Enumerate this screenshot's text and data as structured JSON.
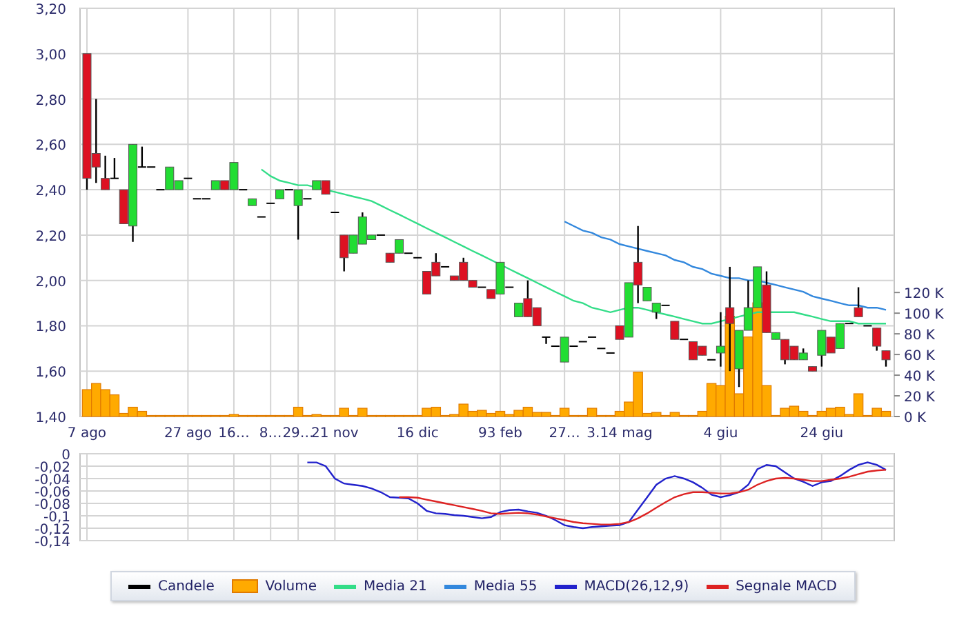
{
  "price_panel": {
    "chart_data": {
      "type": "candlestick",
      "grid": true,
      "categories": [
        "7 ago",
        null,
        null,
        null,
        null,
        null,
        null,
        null,
        null,
        null,
        null,
        "27 ago",
        null,
        null,
        null,
        null,
        "16…",
        null,
        null,
        null,
        "8…",
        null,
        null,
        "29…",
        null,
        null,
        null,
        "21 nov",
        null,
        null,
        null,
        null,
        null,
        null,
        null,
        null,
        "16 dic",
        null,
        null,
        null,
        null,
        null,
        null,
        null,
        null,
        "93 feb",
        null,
        null,
        null,
        null,
        null,
        null,
        "27…",
        null,
        null,
        null,
        null,
        null,
        "3.14 mag",
        null,
        null,
        null,
        null,
        null,
        null,
        null,
        null,
        null,
        null,
        "4 giu",
        null,
        null,
        null,
        null,
        null,
        null,
        null,
        null,
        null,
        null,
        "24 giu",
        null,
        null,
        null,
        null,
        null,
        null,
        null
      ],
      "ylim": [
        1.4,
        3.2
      ],
      "y2lim": [
        0,
        395
      ],
      "yticks": [
        {
          "value": 3.2,
          "label": "3,20"
        },
        {
          "value": 3.0,
          "label": "3,00"
        },
        {
          "value": 2.8,
          "label": "2,80"
        },
        {
          "value": 2.6,
          "label": "2,60"
        },
        {
          "value": 2.4,
          "label": "2,40"
        },
        {
          "value": 2.2,
          "label": "2,20"
        },
        {
          "value": 2.0,
          "label": "2,00"
        },
        {
          "value": 1.8,
          "label": "1,80"
        },
        {
          "value": 1.6,
          "label": "1,60"
        },
        {
          "value": 1.4,
          "label": "1,40"
        }
      ],
      "y2ticks": [
        {
          "value": 120,
          "label": "120 K"
        },
        {
          "value": 100,
          "label": "100 K"
        },
        {
          "value": 80,
          "label": "80 K"
        },
        {
          "value": 60,
          "label": "60 K"
        },
        {
          "value": 40,
          "label": "40 K"
        },
        {
          "value": 20,
          "label": "20 K"
        },
        {
          "value": 0,
          "label": "0 K"
        }
      ],
      "ohlc": [
        [
          3.0,
          3.0,
          2.4,
          2.45
        ],
        [
          2.56,
          2.8,
          2.43,
          2.5
        ],
        [
          2.45,
          2.55,
          2.4,
          2.4
        ],
        [
          2.45,
          2.54,
          2.45,
          2.45
        ],
        [
          2.4,
          2.4,
          2.25,
          2.25
        ],
        [
          2.24,
          2.6,
          2.17,
          2.6
        ],
        [
          2.5,
          2.59,
          2.5,
          2.5
        ],
        [
          2.5,
          2.5,
          2.5,
          2.5
        ],
        [
          2.4,
          2.4,
          2.4,
          2.4
        ],
        [
          2.4,
          2.5,
          2.4,
          2.5
        ],
        [
          2.4,
          2.44,
          2.4,
          2.44
        ],
        [
          2.45,
          2.45,
          2.45,
          2.45
        ],
        [
          2.36,
          2.36,
          2.36,
          2.36
        ],
        [
          2.36,
          2.36,
          2.36,
          2.36
        ],
        [
          2.4,
          2.44,
          2.4,
          2.44
        ],
        [
          2.44,
          2.44,
          2.4,
          2.4
        ],
        [
          2.4,
          2.52,
          2.4,
          2.52
        ],
        [
          2.4,
          2.4,
          2.4,
          2.4
        ],
        [
          2.33,
          2.36,
          2.33,
          2.36
        ],
        [
          2.28,
          2.28,
          2.28,
          2.28
        ],
        [
          2.34,
          2.34,
          2.34,
          2.34
        ],
        [
          2.36,
          2.4,
          2.36,
          2.4
        ],
        [
          2.4,
          2.4,
          2.4,
          2.4
        ],
        [
          2.33,
          2.4,
          2.18,
          2.4
        ],
        [
          2.36,
          2.36,
          2.36,
          2.36
        ],
        [
          2.4,
          2.44,
          2.4,
          2.44
        ],
        [
          2.44,
          2.44,
          2.38,
          2.38
        ],
        [
          2.3,
          2.3,
          2.3,
          2.3
        ],
        [
          2.2,
          2.2,
          2.04,
          2.1
        ],
        [
          2.12,
          2.2,
          2.12,
          2.2
        ],
        [
          2.16,
          2.3,
          2.16,
          2.28
        ],
        [
          2.18,
          2.2,
          2.18,
          2.2
        ],
        [
          2.2,
          2.2,
          2.2,
          2.2
        ],
        [
          2.12,
          2.12,
          2.08,
          2.08
        ],
        [
          2.12,
          2.18,
          2.12,
          2.18
        ],
        [
          2.12,
          2.12,
          2.12,
          2.12
        ],
        [
          2.1,
          2.1,
          2.1,
          2.1
        ],
        [
          2.04,
          2.04,
          1.94,
          1.94
        ],
        [
          2.08,
          2.12,
          2.02,
          2.02
        ],
        [
          2.06,
          2.06,
          2.06,
          2.06
        ],
        [
          2.02,
          2.02,
          2.0,
          2.0
        ],
        [
          2.08,
          2.1,
          2.0,
          2.0
        ],
        [
          2.0,
          2.0,
          1.97,
          1.97
        ],
        [
          1.97,
          1.97,
          1.97,
          1.97
        ],
        [
          1.96,
          1.96,
          1.92,
          1.92
        ],
        [
          1.94,
          2.08,
          1.94,
          2.08
        ],
        [
          1.97,
          1.97,
          1.97,
          1.97
        ],
        [
          1.84,
          1.9,
          1.84,
          1.9
        ],
        [
          1.92,
          2.0,
          1.84,
          1.84
        ],
        [
          1.88,
          1.88,
          1.8,
          1.8
        ],
        [
          1.75,
          1.75,
          1.72,
          1.75
        ],
        [
          1.71,
          1.71,
          1.71,
          1.71
        ],
        [
          1.64,
          1.75,
          1.64,
          1.75
        ],
        [
          1.71,
          1.71,
          1.71,
          1.71
        ],
        [
          1.73,
          1.73,
          1.73,
          1.73
        ],
        [
          1.75,
          1.75,
          1.75,
          1.75
        ],
        [
          1.7,
          1.7,
          1.7,
          1.7
        ],
        [
          1.68,
          1.68,
          1.68,
          1.68
        ],
        [
          1.8,
          1.8,
          1.74,
          1.74
        ],
        [
          1.75,
          1.99,
          1.75,
          1.99
        ],
        [
          2.08,
          2.24,
          1.9,
          1.98
        ],
        [
          1.91,
          1.97,
          1.91,
          1.97
        ],
        [
          1.86,
          1.9,
          1.83,
          1.9
        ],
        [
          1.89,
          1.89,
          1.89,
          1.89
        ],
        [
          1.82,
          1.82,
          1.74,
          1.74
        ],
        [
          1.74,
          1.74,
          1.74,
          1.74
        ],
        [
          1.73,
          1.73,
          1.65,
          1.65
        ],
        [
          1.71,
          1.71,
          1.67,
          1.67
        ],
        [
          1.65,
          1.65,
          1.65,
          1.65
        ],
        [
          1.68,
          1.86,
          1.62,
          1.71
        ],
        [
          1.88,
          2.06,
          1.6,
          1.81
        ],
        [
          1.61,
          1.78,
          1.53,
          1.78
        ],
        [
          1.78,
          2.0,
          1.78,
          1.88
        ],
        [
          1.88,
          2.06,
          1.88,
          2.06
        ],
        [
          1.98,
          2.04,
          1.77,
          1.77
        ],
        [
          1.74,
          1.77,
          1.74,
          1.77
        ],
        [
          1.74,
          1.74,
          1.63,
          1.65
        ],
        [
          1.71,
          1.71,
          1.65,
          1.65
        ],
        [
          1.65,
          1.7,
          1.65,
          1.68
        ],
        [
          1.62,
          1.62,
          1.6,
          1.6
        ],
        [
          1.67,
          1.78,
          1.62,
          1.78
        ],
        [
          1.75,
          1.75,
          1.68,
          1.68
        ],
        [
          1.7,
          1.81,
          1.7,
          1.81
        ],
        [
          1.81,
          1.81,
          1.81,
          1.81
        ],
        [
          1.88,
          1.97,
          1.84,
          1.84
        ],
        [
          1.8,
          1.8,
          1.8,
          1.8
        ],
        [
          1.79,
          1.79,
          1.69,
          1.71
        ],
        [
          1.69,
          1.69,
          1.62,
          1.65
        ]
      ],
      "series": [
        {
          "name": "Volume",
          "type": "bar",
          "axis": "y2",
          "color": "#ffaa00",
          "values": [
            26,
            32,
            26,
            21,
            3,
            9,
            5,
            1,
            1,
            1,
            1,
            1,
            1,
            1,
            1,
            1,
            2,
            1,
            1,
            1,
            1,
            1,
            1,
            9,
            1,
            2,
            1,
            1,
            8,
            1,
            8,
            1,
            1,
            1,
            1,
            1,
            1,
            8,
            9,
            1,
            2,
            12,
            5,
            6,
            3,
            5,
            2,
            6,
            9,
            4,
            4,
            1,
            8,
            1,
            1,
            8,
            1,
            1,
            5,
            14,
            43,
            3,
            4,
            1,
            4,
            1,
            1,
            5,
            32,
            30,
            97,
            22,
            77,
            110,
            30,
            1,
            8,
            10,
            5,
            1,
            5,
            8,
            9,
            2,
            22,
            1,
            8,
            5
          ]
        },
        {
          "name": "Media 21",
          "type": "line",
          "color": "#33dd88",
          "values": [
            null,
            null,
            null,
            null,
            null,
            null,
            null,
            null,
            null,
            null,
            null,
            null,
            null,
            null,
            null,
            null,
            null,
            null,
            null,
            2.49,
            2.46,
            2.44,
            2.43,
            2.42,
            2.42,
            2.41,
            2.4,
            2.39,
            2.38,
            2.37,
            2.36,
            2.35,
            2.33,
            2.31,
            2.29,
            2.27,
            2.25,
            2.23,
            2.21,
            2.19,
            2.17,
            2.15,
            2.13,
            2.11,
            2.09,
            2.07,
            2.05,
            2.03,
            2.01,
            1.99,
            1.97,
            1.95,
            1.93,
            1.91,
            1.9,
            1.88,
            1.87,
            1.86,
            1.87,
            1.88,
            1.88,
            1.87,
            1.86,
            1.85,
            1.84,
            1.83,
            1.82,
            1.81,
            1.81,
            1.82,
            1.83,
            1.84,
            1.85,
            1.86,
            1.86,
            1.86,
            1.86,
            1.86,
            1.85,
            1.84,
            1.83,
            1.82,
            1.82,
            1.82,
            1.81,
            1.81,
            1.81,
            1.81
          ]
        },
        {
          "name": "Media 55",
          "type": "line",
          "color": "#3388dd",
          "values": [
            null,
            null,
            null,
            null,
            null,
            null,
            null,
            null,
            null,
            null,
            null,
            null,
            null,
            null,
            null,
            null,
            null,
            null,
            null,
            null,
            null,
            null,
            null,
            null,
            null,
            null,
            null,
            null,
            null,
            null,
            null,
            null,
            null,
            null,
            null,
            null,
            null,
            null,
            null,
            null,
            null,
            null,
            null,
            null,
            null,
            null,
            null,
            null,
            null,
            null,
            null,
            null,
            2.26,
            2.24,
            2.22,
            2.21,
            2.19,
            2.18,
            2.16,
            2.15,
            2.14,
            2.13,
            2.12,
            2.11,
            2.09,
            2.08,
            2.06,
            2.05,
            2.03,
            2.02,
            2.01,
            2.01,
            2.0,
            2.0,
            1.99,
            1.98,
            1.97,
            1.96,
            1.95,
            1.93,
            1.92,
            1.91,
            1.9,
            1.89,
            1.89,
            1.88,
            1.88,
            1.87
          ]
        }
      ]
    },
    "candle_legend": {
      "label": "Candele",
      "color": "#000000"
    }
  },
  "macd_panel": {
    "chart_data": {
      "type": "line",
      "grid": true,
      "ylim": [
        -0.14,
        0
      ],
      "yticks": [
        {
          "value": 0,
          "label": "0"
        },
        {
          "value": -0.02,
          "label": "-0,02"
        },
        {
          "value": -0.04,
          "label": "-0,04"
        },
        {
          "value": -0.06,
          "label": "-0,06"
        },
        {
          "value": -0.08,
          "label": "-0,08"
        },
        {
          "value": -0.1,
          "label": "-0,1"
        },
        {
          "value": -0.12,
          "label": "-0,12"
        },
        {
          "value": -0.14,
          "label": "-0,14"
        }
      ],
      "series": [
        {
          "name": "MACD(26,12,9)",
          "color": "#2222cc",
          "values": [
            null,
            null,
            null,
            null,
            null,
            null,
            null,
            null,
            null,
            null,
            null,
            null,
            null,
            null,
            null,
            null,
            null,
            null,
            null,
            null,
            null,
            null,
            null,
            null,
            -0.014,
            -0.014,
            -0.02,
            -0.04,
            -0.048,
            -0.05,
            -0.052,
            -0.056,
            -0.062,
            -0.07,
            -0.071,
            -0.072,
            -0.08,
            -0.092,
            -0.096,
            -0.097,
            -0.099,
            -0.1,
            -0.102,
            -0.104,
            -0.102,
            -0.094,
            -0.091,
            -0.09,
            -0.093,
            -0.095,
            -0.1,
            -0.107,
            -0.115,
            -0.118,
            -0.12,
            -0.118,
            -0.117,
            -0.116,
            -0.115,
            -0.11,
            -0.09,
            -0.07,
            -0.05,
            -0.04,
            -0.036,
            -0.04,
            -0.046,
            -0.055,
            -0.066,
            -0.07,
            -0.067,
            -0.062,
            -0.05,
            -0.025,
            -0.018,
            -0.02,
            -0.03,
            -0.04,
            -0.045,
            -0.052,
            -0.046,
            -0.044,
            -0.036,
            -0.026,
            -0.018,
            -0.014,
            -0.018,
            -0.026
          ]
        },
        {
          "name": "Segnale MACD",
          "color": "#dd2222",
          "values": [
            null,
            null,
            null,
            null,
            null,
            null,
            null,
            null,
            null,
            null,
            null,
            null,
            null,
            null,
            null,
            null,
            null,
            null,
            null,
            null,
            null,
            null,
            null,
            null,
            null,
            null,
            null,
            null,
            null,
            null,
            null,
            null,
            null,
            null,
            -0.07,
            -0.07,
            -0.071,
            -0.074,
            -0.077,
            -0.08,
            -0.083,
            -0.086,
            -0.089,
            -0.092,
            -0.096,
            -0.097,
            -0.096,
            -0.095,
            -0.096,
            -0.098,
            -0.101,
            -0.104,
            -0.107,
            -0.11,
            -0.112,
            -0.113,
            -0.114,
            -0.114,
            -0.113,
            -0.11,
            -0.104,
            -0.096,
            -0.087,
            -0.078,
            -0.07,
            -0.065,
            -0.062,
            -0.062,
            -0.063,
            -0.064,
            -0.064,
            -0.062,
            -0.058,
            -0.05,
            -0.044,
            -0.04,
            -0.039,
            -0.04,
            -0.042,
            -0.044,
            -0.044,
            -0.042,
            -0.04,
            -0.037,
            -0.033,
            -0.029,
            -0.027,
            -0.026
          ]
        }
      ]
    }
  }
}
